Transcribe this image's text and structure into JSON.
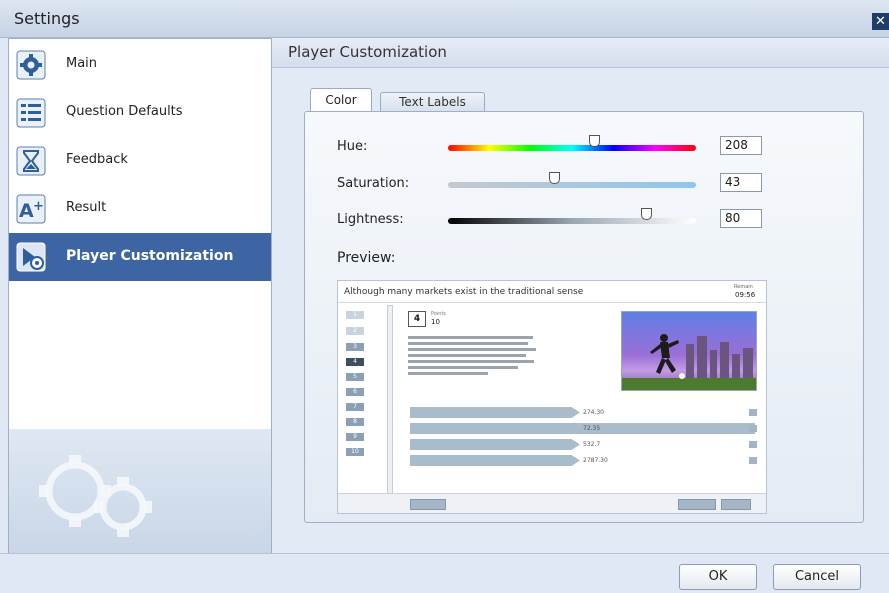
{
  "window": {
    "title": "Settings",
    "close_icon": "close-icon"
  },
  "sidebar": {
    "items": [
      {
        "label": "Main",
        "icon": "gear-icon"
      },
      {
        "label": "Question Defaults",
        "icon": "list-icon"
      },
      {
        "label": "Feedback",
        "icon": "hourglass-icon"
      },
      {
        "label": "Result",
        "icon": "a-plus-icon"
      },
      {
        "label": "Player Customization",
        "icon": "player-icon"
      }
    ],
    "active_index": 4
  },
  "main": {
    "header": "Player Customization",
    "tabs": [
      {
        "label": "Color"
      },
      {
        "label": "Text Labels"
      }
    ],
    "active_tab": "Color",
    "hue": {
      "label": "Hue:",
      "value": "208",
      "level": 0.59
    },
    "saturation": {
      "label": "Saturation:",
      "value": "43",
      "level": 0.43
    },
    "lightness": {
      "label": "Lightness:",
      "value": "80",
      "level": 0.8
    },
    "preview_label": "Preview:"
  },
  "preview": {
    "question": "Although many markets exist in the traditional sense",
    "remaining_label": "Remain",
    "timer": "09:56",
    "question_numbers": [
      "1",
      "2",
      "3",
      "4",
      "5",
      "6",
      "7",
      "8",
      "9",
      "10"
    ],
    "current_question": "4",
    "points_label": "Points",
    "points": "10",
    "answers": [
      "274.30",
      "72.35",
      "532.7",
      "2787.30"
    ]
  },
  "footer": {
    "ok_label": "OK",
    "cancel_label": "Cancel"
  },
  "colors": {
    "accent": "#3d64a3",
    "panel": "#e2eaf5"
  }
}
